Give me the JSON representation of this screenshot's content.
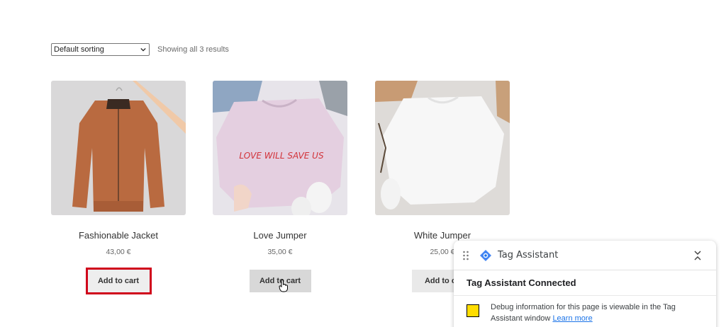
{
  "toolbar": {
    "sort_value": "Default sorting",
    "results_text": "Showing all 3 results"
  },
  "products": [
    {
      "title": "Fashionable Jacket",
      "price": "43,00 €",
      "button": "Add to cart",
      "image": "orange-jacket-photo"
    },
    {
      "title": "Love Jumper",
      "price": "35,00 €",
      "button": "Add to cart",
      "image": "pink-sweatshirt-photo",
      "print": "LOVE WILL SAVE US"
    },
    {
      "title": "White Jumper",
      "price": "25,00 €",
      "button": "Add to ca",
      "image": "white-sweatshirt-photo"
    }
  ],
  "tag_assistant": {
    "name": "Tag Assistant",
    "status": "Tag Assistant Connected",
    "message": "Debug information for this page is viewable in the Tag Assistant window",
    "link": "Learn more",
    "status_color": "#ffdd00"
  },
  "colors": {
    "highlight": "#d0021b",
    "button_bg": "#e9e9e9",
    "link": "#1a73e8"
  }
}
